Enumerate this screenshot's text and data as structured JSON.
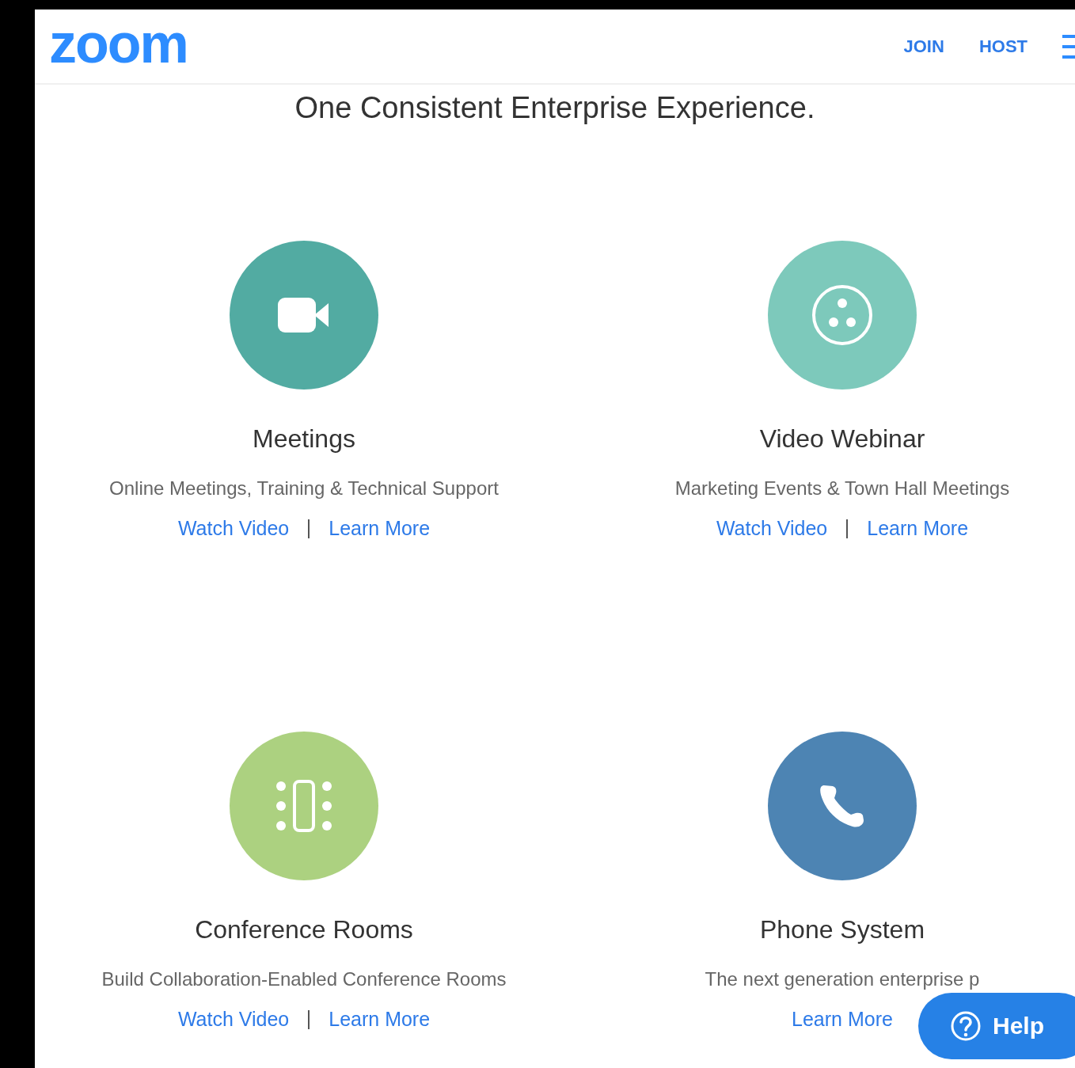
{
  "header": {
    "logo": "zoom",
    "nav": [
      {
        "label": "JOIN"
      },
      {
        "label": "HOST"
      }
    ]
  },
  "heading": "One Consistent Enterprise Experience.",
  "products": [
    {
      "color": "#52aba2",
      "title": "Meetings",
      "description": "Online Meetings, Training & Technical Support",
      "links": [
        "Watch Video",
        "Learn More"
      ]
    },
    {
      "color": "#7dc9bb",
      "title": "Video Webinar",
      "description": "Marketing Events & Town Hall Meetings",
      "links": [
        "Watch Video",
        "Learn More"
      ]
    },
    {
      "color": "#acd180",
      "title": "Conference Rooms",
      "description": "Build Collaboration-Enabled Conference Rooms",
      "links": [
        "Watch Video",
        "Learn More"
      ]
    },
    {
      "color": "#4d84b3",
      "title": "Phone System",
      "description": "The next generation enterprise p",
      "links": [
        "Learn More"
      ]
    }
  ],
  "help": {
    "label": "Help"
  }
}
